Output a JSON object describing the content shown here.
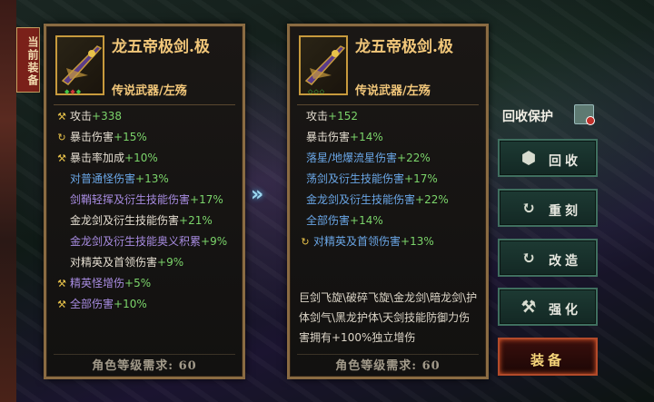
{
  "current_tag": "当前装备",
  "left_item": {
    "name": "龙五帝极剑.极",
    "type": "传说武器/左殇",
    "stats": [
      {
        "icon": "hammer-icon",
        "label": "攻击",
        "value": "+338",
        "style": "white"
      },
      {
        "icon": "refresh-icon",
        "label": "暴击伤害",
        "value": "+15%",
        "style": "white"
      },
      {
        "icon": "hammer-icon",
        "label": "暴击率加成",
        "value": "+10%",
        "style": "white"
      },
      {
        "icon": "",
        "label": "对普通怪伤害",
        "value": "+13%",
        "style": "blue"
      },
      {
        "icon": "",
        "label": "剑鞘轻挥及衍生技能伤害",
        "value": "+17%",
        "style": "purple"
      },
      {
        "icon": "",
        "label": "金龙剑及衍生技能伤害",
        "value": "+21%",
        "style": "white"
      },
      {
        "icon": "",
        "label": "金龙剑及衍生技能奥义积累",
        "value": "+9%",
        "style": "purple"
      },
      {
        "icon": "",
        "label": "对精英及首领伤害",
        "value": "+9%",
        "style": "white"
      },
      {
        "icon": "hammer-icon",
        "label": "精英怪增伤",
        "value": "+5%",
        "style": "purple"
      },
      {
        "icon": "hammer-icon",
        "label": "全部伤害",
        "value": "+10%",
        "style": "purple"
      }
    ],
    "requirement": "角色等级需求: 60"
  },
  "right_item": {
    "name": "龙五帝极剑.极",
    "type": "传说武器/左殇",
    "stats": [
      {
        "icon": "",
        "label": "攻击",
        "value": "+152",
        "style": "white"
      },
      {
        "icon": "",
        "label": "暴击伤害",
        "value": "+14%",
        "style": "white"
      },
      {
        "icon": "",
        "label": "落星/地爆流星伤害",
        "value": "+22%",
        "style": "blue"
      },
      {
        "icon": "",
        "label": "荡剑及衍生技能伤害",
        "value": "+17%",
        "style": "blue"
      },
      {
        "icon": "",
        "label": "金龙剑及衍生技能伤害",
        "value": "+22%",
        "style": "blue"
      },
      {
        "icon": "",
        "label": "全部伤害",
        "value": "+14%",
        "style": "blue"
      },
      {
        "icon": "refresh-icon",
        "label": "对精英及首领伤害",
        "value": "+13%",
        "style": "blue"
      }
    ],
    "description": "巨剑飞旋\\破碎飞旋\\金龙剑\\暗龙剑\\护体剑气\\黑龙护体\\天剑技能防御力伤害拥有+100%独立增伤",
    "requirement": "角色等级需求: 60"
  },
  "compare_arrow": "»",
  "protect_label": "回收保护",
  "buttons": [
    {
      "id": "recycle",
      "label": "回收",
      "icon": "cube-icon"
    },
    {
      "id": "reforge",
      "label": "重刻",
      "icon": "refresh-icon"
    },
    {
      "id": "remake",
      "label": "改造",
      "icon": "refresh-icon"
    },
    {
      "id": "enhance",
      "label": "强化",
      "icon": "hammer-icon"
    },
    {
      "id": "equip",
      "label": "装备",
      "icon": ""
    }
  ],
  "colors": {
    "gold": "#f2c77a",
    "green": "#7bd46a",
    "blue": "#6aa6e6",
    "purple": "#a78be0",
    "frame": "#8a6b42"
  }
}
